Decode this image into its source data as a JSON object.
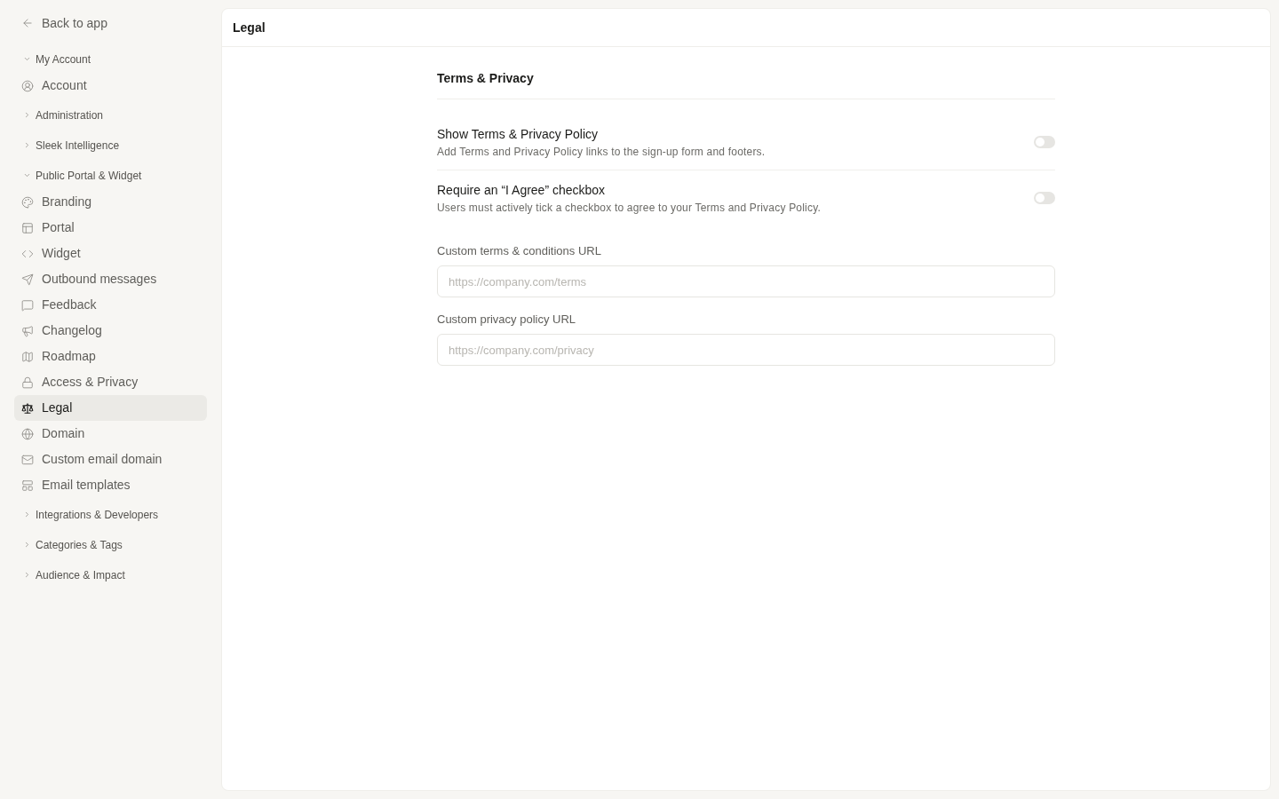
{
  "sidebar": {
    "back_link": "Back to app",
    "groups": [
      {
        "label": "My Account",
        "expanded": true,
        "items": [
          {
            "label": "Account",
            "selected": false
          }
        ]
      },
      {
        "label": "Administration",
        "expanded": false
      },
      {
        "label": "Sleek Intelligence",
        "expanded": false
      },
      {
        "label": "Public Portal & Widget",
        "expanded": true,
        "items": [
          {
            "label": "Branding",
            "selected": false
          },
          {
            "label": "Portal",
            "selected": false
          },
          {
            "label": "Widget",
            "selected": false
          },
          {
            "label": "Outbound messages",
            "selected": false
          },
          {
            "label": "Feedback",
            "selected": false
          },
          {
            "label": "Changelog",
            "selected": false
          },
          {
            "label": "Roadmap",
            "selected": false
          },
          {
            "label": "Access & Privacy",
            "selected": false
          },
          {
            "label": "Legal",
            "selected": true
          },
          {
            "label": "Domain",
            "selected": false
          },
          {
            "label": "Custom email domain",
            "selected": false
          },
          {
            "label": "Email templates",
            "selected": false
          }
        ]
      },
      {
        "label": "Integrations & Developers",
        "expanded": false
      },
      {
        "label": "Categories & Tags",
        "expanded": false
      },
      {
        "label": "Audience & Impact",
        "expanded": false
      }
    ]
  },
  "page": {
    "title": "Legal"
  },
  "section": {
    "title": "Terms & Privacy",
    "toggles": [
      {
        "label": "Show Terms & Privacy Policy",
        "description": "Add Terms and Privacy Policy links to the sign-up form and footers.",
        "on": false
      },
      {
        "label": "Require an “I Agree” checkbox",
        "description": "Users must actively tick a checkbox to agree to your Terms and Privacy Policy.",
        "on": false
      }
    ],
    "fields": [
      {
        "label": "Custom terms & conditions URL",
        "placeholder": "https://company.com/terms"
      },
      {
        "label": "Custom privacy policy URL",
        "placeholder": "https://company.com/privacy"
      }
    ]
  }
}
